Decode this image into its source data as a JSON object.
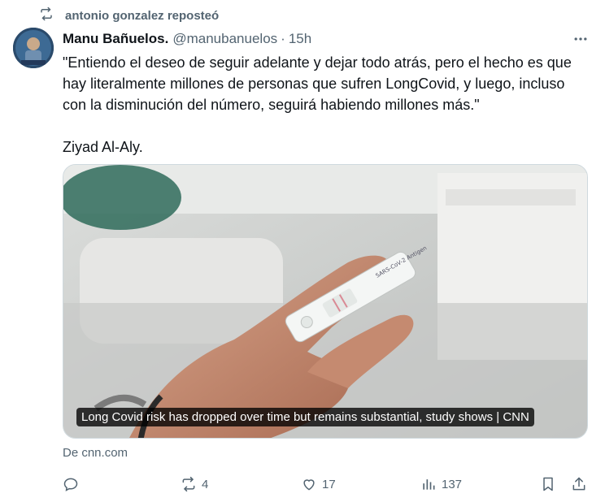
{
  "repost": {
    "icon": "repost-icon",
    "text": "antonio gonzalez reposteó"
  },
  "author": {
    "name": "Manu Bañuelos.",
    "handle": "@manubanuelos",
    "separator": "·",
    "time": "15h",
    "avatar_icon": "avatar"
  },
  "tweet": {
    "paragraphs": [
      "\"Entiendo el deseo de seguir adelante y dejar todo atrás, pero el hecho es que hay literalmente millones de personas que sufren LongCovid, y luego, incluso con la disminución del número, seguirá habiendo millones más.\"",
      "Ziyad Al-Aly."
    ]
  },
  "card": {
    "caption": "Long Covid risk has dropped over time but remains substantial, study shows | CNN",
    "source": "De cnn.com",
    "test_label": "SARS-CoV-2 Antigen"
  },
  "actions": {
    "reply_count": "",
    "repost_count": "4",
    "like_count": "17",
    "views_count": "137"
  },
  "colors": {
    "text": "#0f1419",
    "muted": "#536471",
    "border": "#cfd9de"
  }
}
